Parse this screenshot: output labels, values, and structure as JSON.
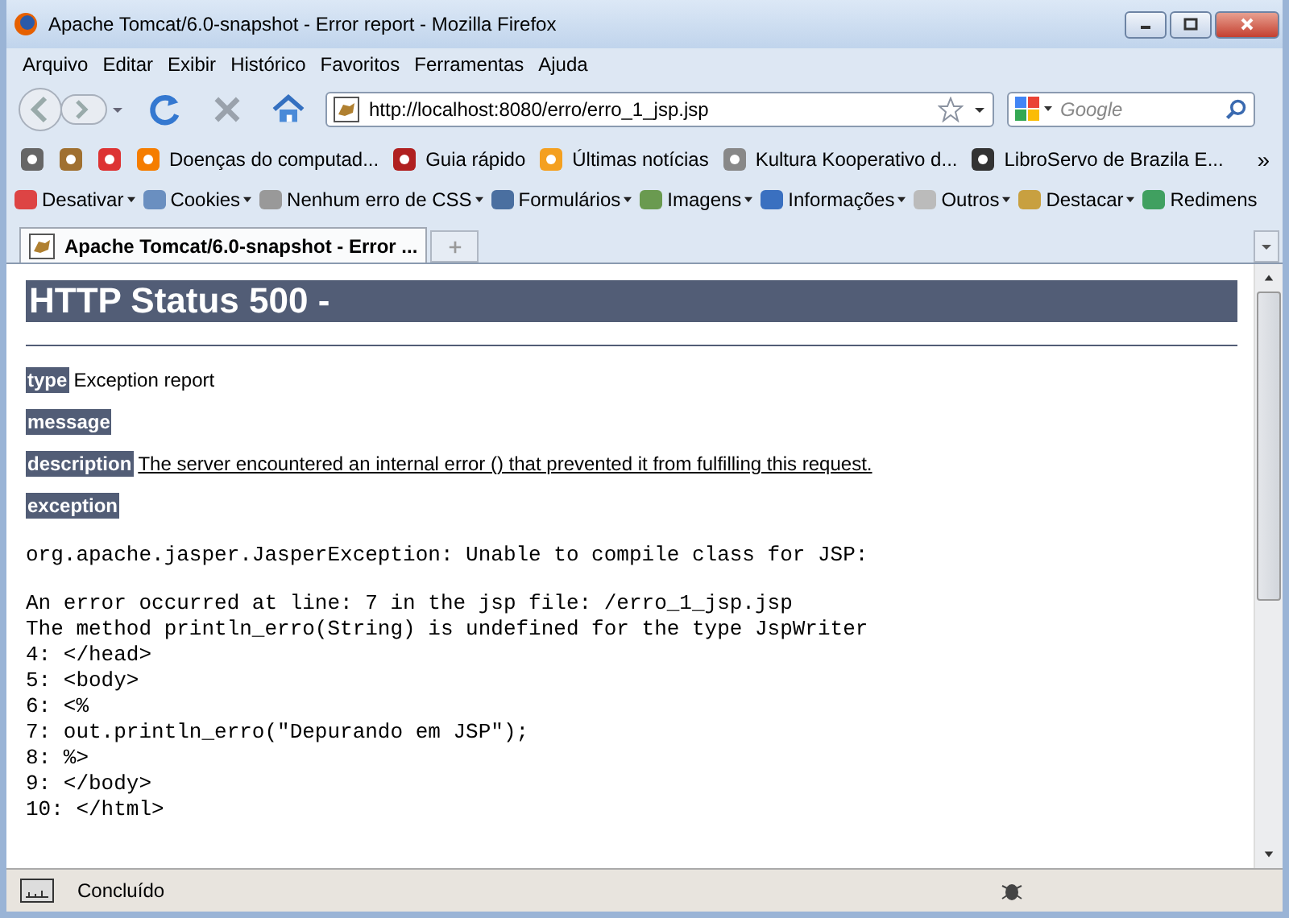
{
  "window": {
    "title": "Apache Tomcat/6.0-snapshot - Error report - Mozilla Firefox"
  },
  "menu": [
    {
      "label": "Arquivo"
    },
    {
      "label": "Editar"
    },
    {
      "label": "Exibir"
    },
    {
      "label": "Histórico"
    },
    {
      "label": "Favoritos"
    },
    {
      "label": "Ferramentas"
    },
    {
      "label": "Ajuda"
    }
  ],
  "address": {
    "value": "http://localhost:8080/erro/erro_1_jsp.jsp"
  },
  "search": {
    "placeholder": "Google"
  },
  "bookmarks": [
    {
      "kind": "icon"
    },
    {
      "kind": "icon"
    },
    {
      "kind": "icon"
    },
    {
      "kind": "link",
      "label": "Doenças do computad..."
    },
    {
      "kind": "link",
      "label": "Guia rápido"
    },
    {
      "kind": "link",
      "label": "Últimas notícias"
    },
    {
      "kind": "link",
      "label": "Kultura Kooperativo d..."
    },
    {
      "kind": "link",
      "label": "LibroServo de Brazila E..."
    }
  ],
  "bookmarks_more": "»",
  "addons": [
    {
      "label": "Desativar"
    },
    {
      "label": "Cookies"
    },
    {
      "label": "Nenhum erro de CSS"
    },
    {
      "label": "Formulários"
    },
    {
      "label": "Imagens"
    },
    {
      "label": "Informações"
    },
    {
      "label": "Outros"
    },
    {
      "label": "Destacar"
    },
    {
      "label": "Redimens"
    }
  ],
  "tabs": [
    {
      "title": "Apache Tomcat/6.0-snapshot - Error ...",
      "selected": true
    }
  ],
  "page": {
    "heading": "HTTP Status 500 -",
    "fields": [
      {
        "label": "type",
        "value": "Exception report"
      },
      {
        "label": "message"
      },
      {
        "label": "description",
        "value": "The server encountered an internal error () that prevented it from fulfilling this request."
      },
      {
        "label": "exception"
      }
    ],
    "trace_blocks": [
      {
        "lines": [
          "org.apache.jasper.JasperException: Unable to compile class for JSP:"
        ]
      },
      {
        "lines": [
          "An error occurred at line: 7 in the jsp file: /erro_1_jsp.jsp",
          "The method println_erro(String) is undefined for the type JspWriter",
          "4: </head>",
          "5: <body>",
          "6: <%",
          "7: out.println_erro(\"Depurando em JSP\");",
          "8: %>",
          "9: </body>",
          "10: </html>"
        ]
      }
    ]
  },
  "status_bar": {
    "text": "Concluído"
  }
}
